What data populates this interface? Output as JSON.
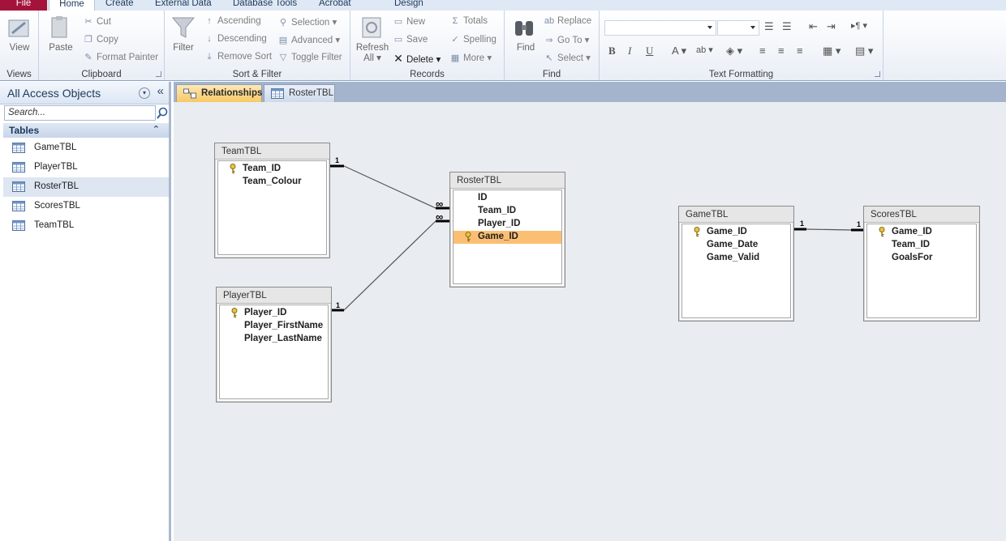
{
  "ribbon_tabs": [
    "File",
    "Home",
    "Create",
    "External Data",
    "Database Tools",
    "Acrobat",
    "Design"
  ],
  "groups": {
    "views": {
      "label": "Views",
      "view": "View"
    },
    "clipboard": {
      "label": "Clipboard",
      "paste": "Paste",
      "cut": "Cut",
      "copy": "Copy",
      "format_painter": "Format Painter"
    },
    "sort_filter": {
      "label": "Sort & Filter",
      "filter": "Filter",
      "ascending": "Ascending",
      "descending": "Descending",
      "remove_sort": "Remove Sort",
      "selection": "Selection",
      "advanced": "Advanced",
      "toggle_filter": "Toggle Filter"
    },
    "records": {
      "label": "Records",
      "refresh": "Refresh",
      "refresh_all": "All",
      "new": "New",
      "save": "Save",
      "delete": "Delete",
      "totals": "Totals",
      "spelling": "Spelling",
      "more": "More"
    },
    "find": {
      "label": "Find",
      "find": "Find",
      "replace": "Replace",
      "goto": "Go To",
      "select": "Select"
    },
    "text_formatting": {
      "label": "Text Formatting",
      "bold": "B",
      "italic": "I",
      "underline": "U"
    }
  },
  "nav": {
    "title": "All Access Objects",
    "search_placeholder": "Search...",
    "section": "Tables",
    "items": [
      "GameTBL",
      "PlayerTBL",
      "RosterTBL",
      "ScoresTBL",
      "TeamTBL"
    ],
    "selected": "RosterTBL"
  },
  "doc_tabs": [
    "Relationships",
    "RosterTBL"
  ],
  "tables": {
    "team": {
      "title": "TeamTBL",
      "fields": [
        "Team_ID",
        "Team_Colour"
      ],
      "key": "Team_ID"
    },
    "player": {
      "title": "PlayerTBL",
      "fields": [
        "Player_ID",
        "Player_FirstName",
        "Player_LastName"
      ],
      "key": "Player_ID"
    },
    "roster": {
      "title": "RosterTBL",
      "fields": [
        "ID",
        "Team_ID",
        "Player_ID",
        "Game_ID"
      ],
      "key": "Game_ID",
      "highlighted": "Game_ID"
    },
    "game": {
      "title": "GameTBL",
      "fields": [
        "Game_ID",
        "Game_Date",
        "Game_Valid"
      ],
      "key": "Game_ID"
    },
    "scores": {
      "title": "ScoresTBL",
      "fields": [
        "Game_ID",
        "Team_ID",
        "GoalsFor"
      ],
      "key": "Game_ID"
    }
  },
  "relationships": {
    "one": "1",
    "many": "∞"
  }
}
